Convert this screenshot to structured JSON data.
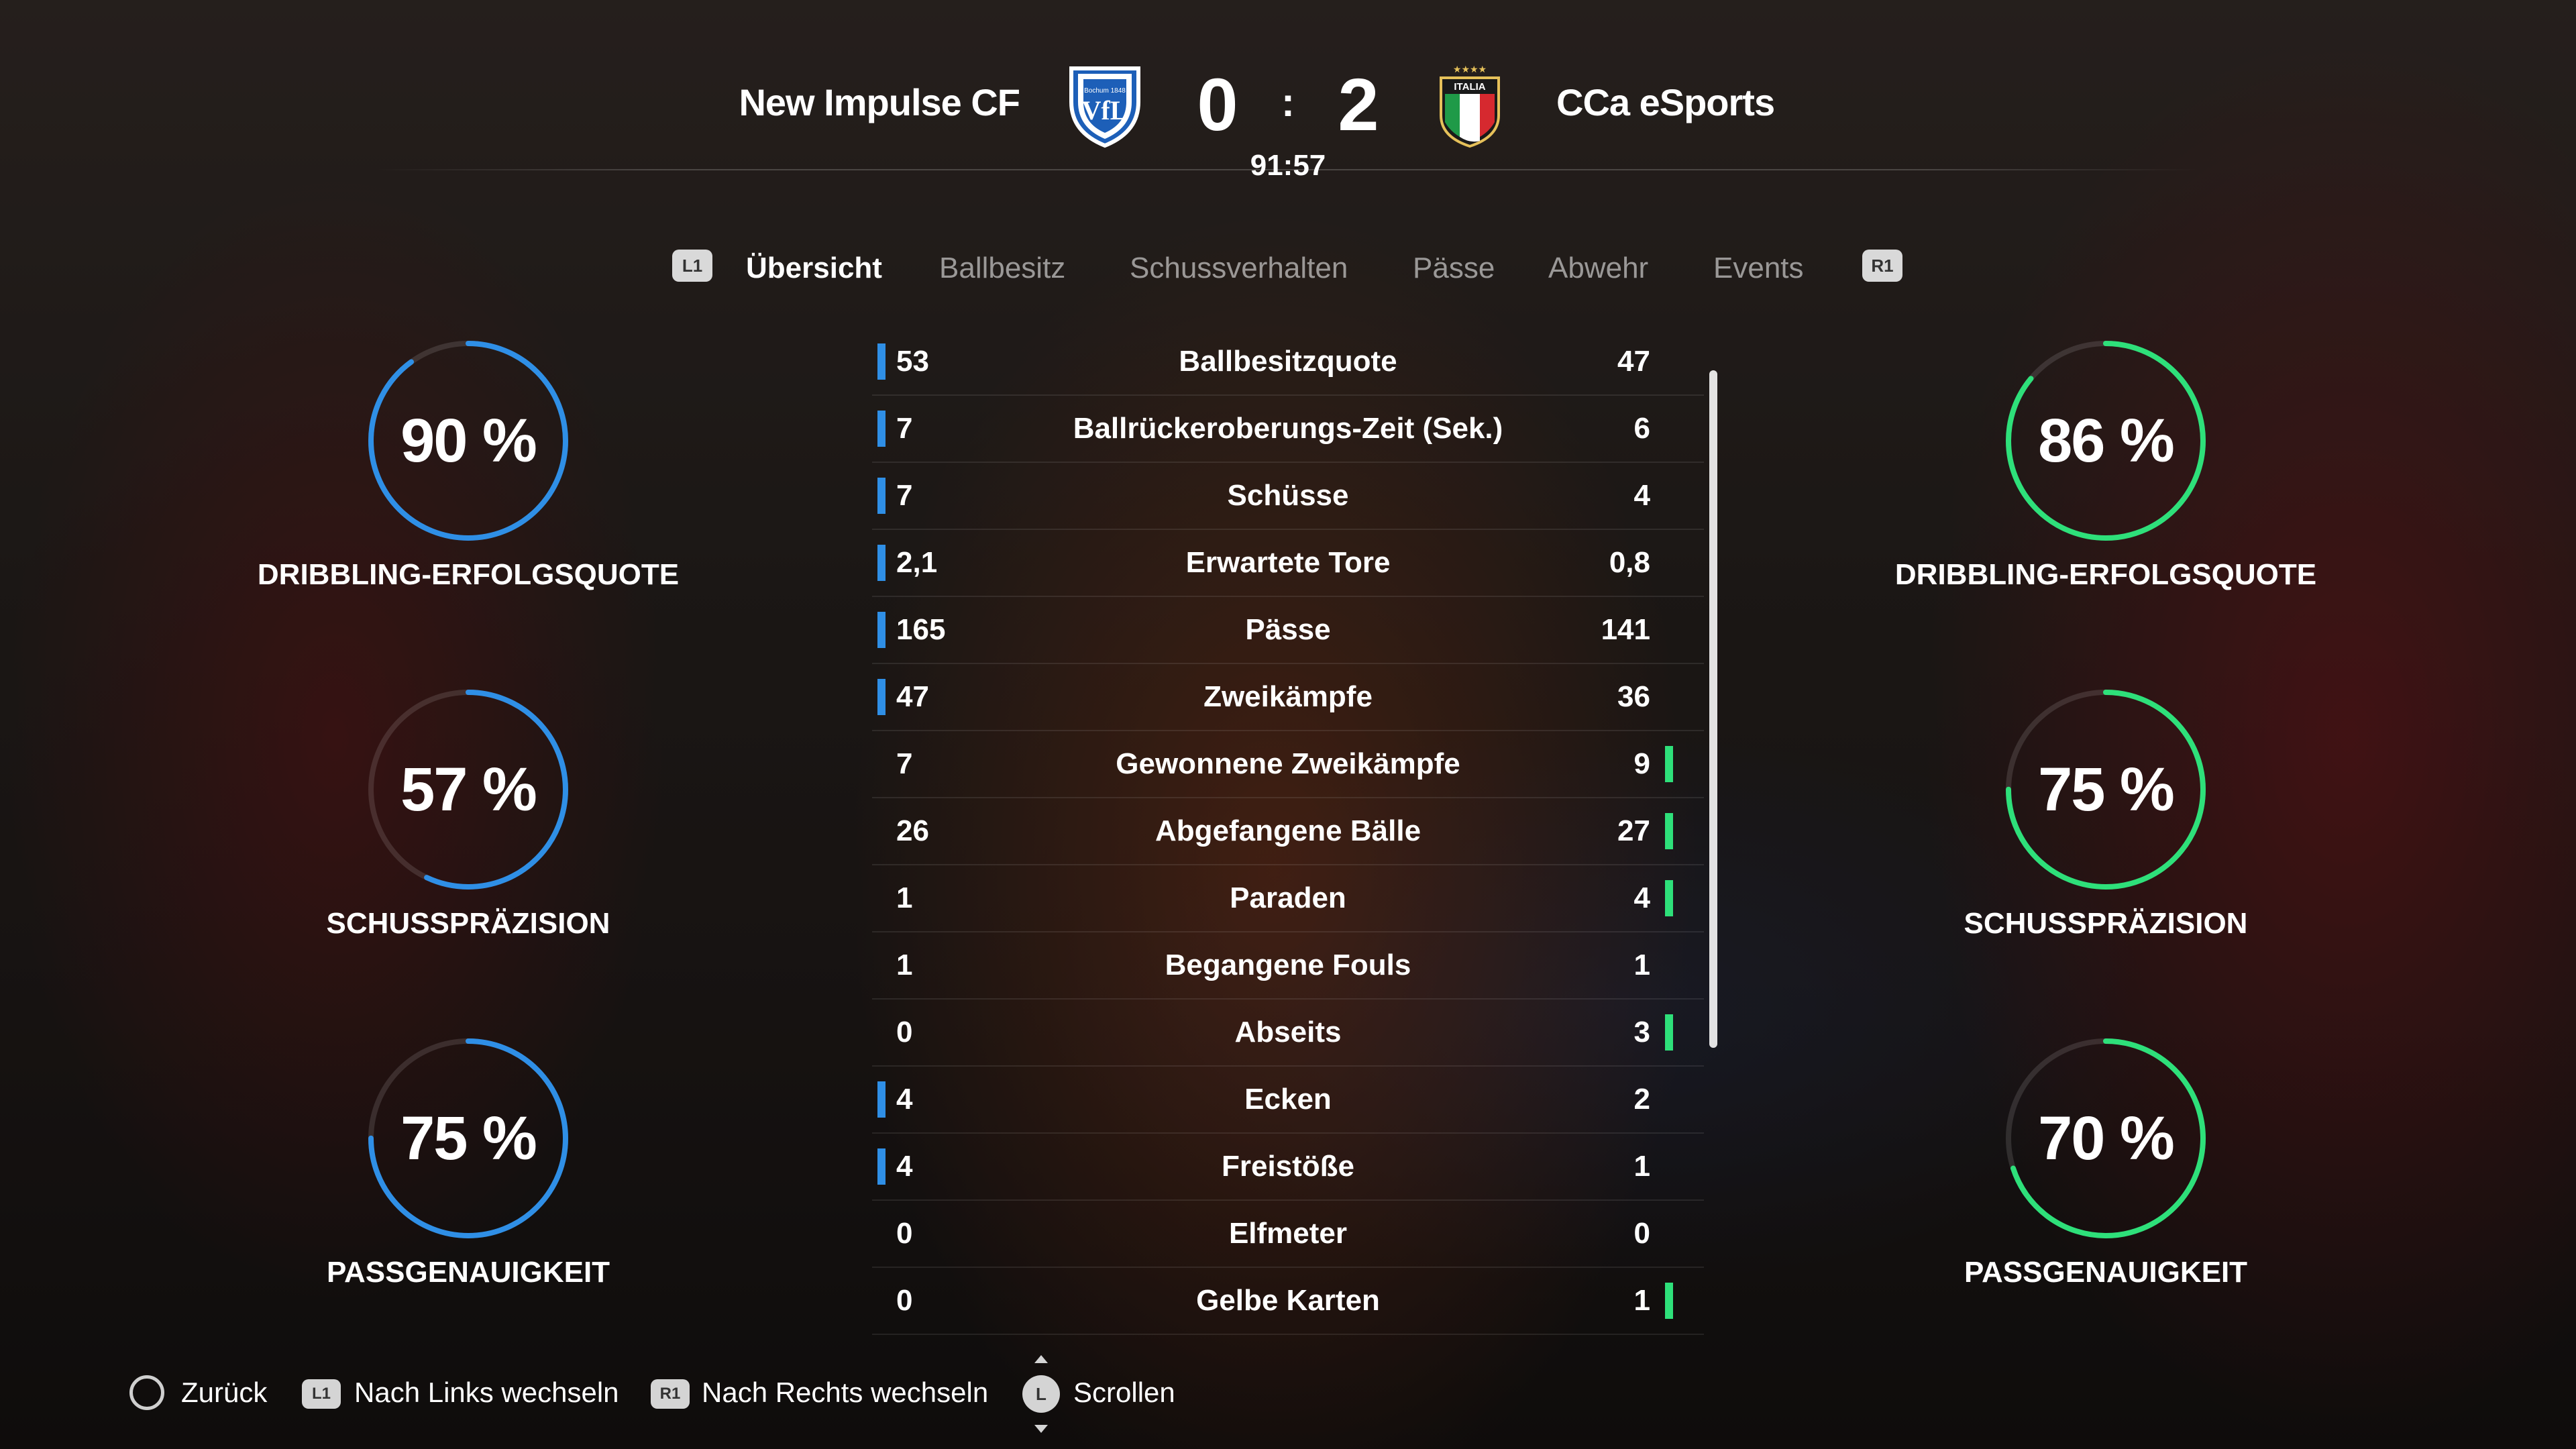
{
  "match": {
    "home_team": "New Impulse CF",
    "away_team": "CCa eSports",
    "home_score": "0",
    "away_score": "2",
    "score_separator": ":",
    "clock": "91:57",
    "home_crest_text": "VfL",
    "home_crest_sub": "Bochum 1848",
    "away_crest_text": "ITALIA"
  },
  "tabs": {
    "left_button": "L1",
    "right_button": "R1",
    "items": [
      {
        "label": "Übersicht",
        "active": true
      },
      {
        "label": "Ballbesitz",
        "active": false
      },
      {
        "label": "Schussverhalten",
        "active": false
      },
      {
        "label": "Pässe",
        "active": false
      },
      {
        "label": "Abwehr",
        "active": false
      },
      {
        "label": "Events",
        "active": false
      }
    ]
  },
  "home_rings": [
    {
      "value": "90 %",
      "fraction": 0.9,
      "label": "DRIBBLING-ERFOLGSQUOTE"
    },
    {
      "value": "57 %",
      "fraction": 0.57,
      "label": "SCHUSSPRÄZISION"
    },
    {
      "value": "75 %",
      "fraction": 0.75,
      "label": "PASSGENAUIGKEIT"
    }
  ],
  "away_rings": [
    {
      "value": "86 %",
      "fraction": 0.86,
      "label": "DRIBBLING-ERFOLGSQUOTE"
    },
    {
      "value": "75 %",
      "fraction": 0.75,
      "label": "SCHUSSPRÄZISION"
    },
    {
      "value": "70 %",
      "fraction": 0.7,
      "label": "PASSGENAUIGKEIT"
    }
  ],
  "colors": {
    "home_accent": "#2f8fe6",
    "away_accent": "#2ee07a"
  },
  "stats": [
    {
      "home": "53",
      "name": "Ballbesitzquote",
      "away": "47",
      "leader": "home"
    },
    {
      "home": "7",
      "name": "Ballrückeroberungs-Zeit (Sek.)",
      "away": "6",
      "leader": "home"
    },
    {
      "home": "7",
      "name": "Schüsse",
      "away": "4",
      "leader": "home"
    },
    {
      "home": "2,1",
      "name": "Erwartete Tore",
      "away": "0,8",
      "leader": "home"
    },
    {
      "home": "165",
      "name": "Pässe",
      "away": "141",
      "leader": "home"
    },
    {
      "home": "47",
      "name": "Zweikämpfe",
      "away": "36",
      "leader": "home"
    },
    {
      "home": "7",
      "name": "Gewonnene Zweikämpfe",
      "away": "9",
      "leader": "away"
    },
    {
      "home": "26",
      "name": "Abgefangene Bälle",
      "away": "27",
      "leader": "away"
    },
    {
      "home": "1",
      "name": "Paraden",
      "away": "4",
      "leader": "away"
    },
    {
      "home": "1",
      "name": "Begangene Fouls",
      "away": "1",
      "leader": "none"
    },
    {
      "home": "0",
      "name": "Abseits",
      "away": "3",
      "leader": "away"
    },
    {
      "home": "4",
      "name": "Ecken",
      "away": "2",
      "leader": "home"
    },
    {
      "home": "4",
      "name": "Freistöße",
      "away": "1",
      "leader": "home"
    },
    {
      "home": "0",
      "name": "Elfmeter",
      "away": "0",
      "leader": "none"
    },
    {
      "home": "0",
      "name": "Gelbe Karten",
      "away": "1",
      "leader": "away"
    }
  ],
  "footer": {
    "back": "Zurück",
    "left_button": "L1",
    "left": "Nach Links wechseln",
    "right_button": "R1",
    "right": "Nach Rechts wechseln",
    "stick": "L",
    "scroll": "Scrollen"
  }
}
